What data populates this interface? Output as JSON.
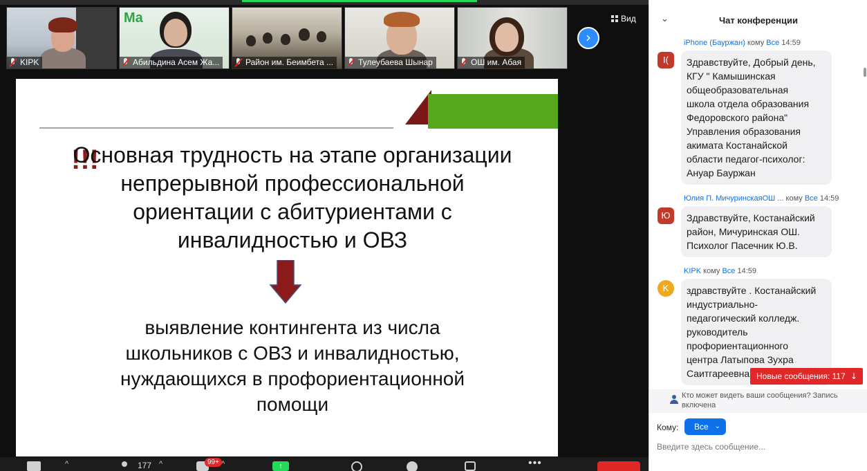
{
  "participants": [
    {
      "name": "KIPK"
    },
    {
      "name": "Абильдина Асем Жа..."
    },
    {
      "name": "Район им. Беимбета ..."
    },
    {
      "name": "Тулеубаева Шынар"
    },
    {
      "name": "ОШ им. Абая"
    }
  ],
  "view_button": {
    "label": "Вид",
    "icon": "grid-icon"
  },
  "next_page_icon": "chevron-right-icon",
  "slide": {
    "exclamation": "!!!",
    "heading": "Основная трудность на этапе организации непрерывной профессиональной ориентации с абитуриентами с инвалидностью и ОВЗ",
    "body": "выявление контингента из числа школьников с ОВЗ и инвалидностью, нуждающихся в профориентационной помощи",
    "colors": {
      "accent_green": "#58a81e",
      "accent_red": "#7a1818",
      "exclaim": "#8b1a1a"
    }
  },
  "toolbar": {
    "participants_count": "177",
    "chat_badge": "99+"
  },
  "chat": {
    "title": "Чат конференции",
    "messages": [
      {
        "avatar": "I(",
        "avatar_color": "#c0392b",
        "sender": "iPhone (Бауржан)",
        "to_word": "кому",
        "recipient": "Все",
        "time": "14:59",
        "text": "Здравствуйте, Добрый день,\nКГУ \" Камышинская\nобщеобразовательная\nшкола  отдела образования\nФедоровского района\"\nУправления образования\nакимата Костанайской\nобласти педагог-психолог:\nАнуар Бауржан"
      },
      {
        "avatar": "Ю",
        "avatar_color": "#c0392b",
        "sender": "Юлия П. МичуринскаяОШ ...",
        "to_word": "кому",
        "recipient": "Все",
        "time": "14:59",
        "text": "Здравствуйте, Костанайский\nрайон, Мичуринская ОШ.\nПсихолог Пасечник Ю.В."
      },
      {
        "avatar": "K",
        "avatar_color": "#f0a81c",
        "sender": "KIPK",
        "to_word": "кому",
        "recipient": "Все",
        "time": "14:59",
        "text": "здравствуйте . Костанайский\nиндустриально-\nпедагогический колледж.\nруководитель\nпрофориентационного\nцентра Латыпова Зухра\nСаитгареевна"
      }
    ],
    "new_messages": "Новые сообщения: 117",
    "privacy_note": "Кто может видеть ваши сообщения? Запись включена",
    "to_label": "Кому:",
    "to_value": "Все",
    "input_placeholder": "Введите здесь сообщение..."
  }
}
